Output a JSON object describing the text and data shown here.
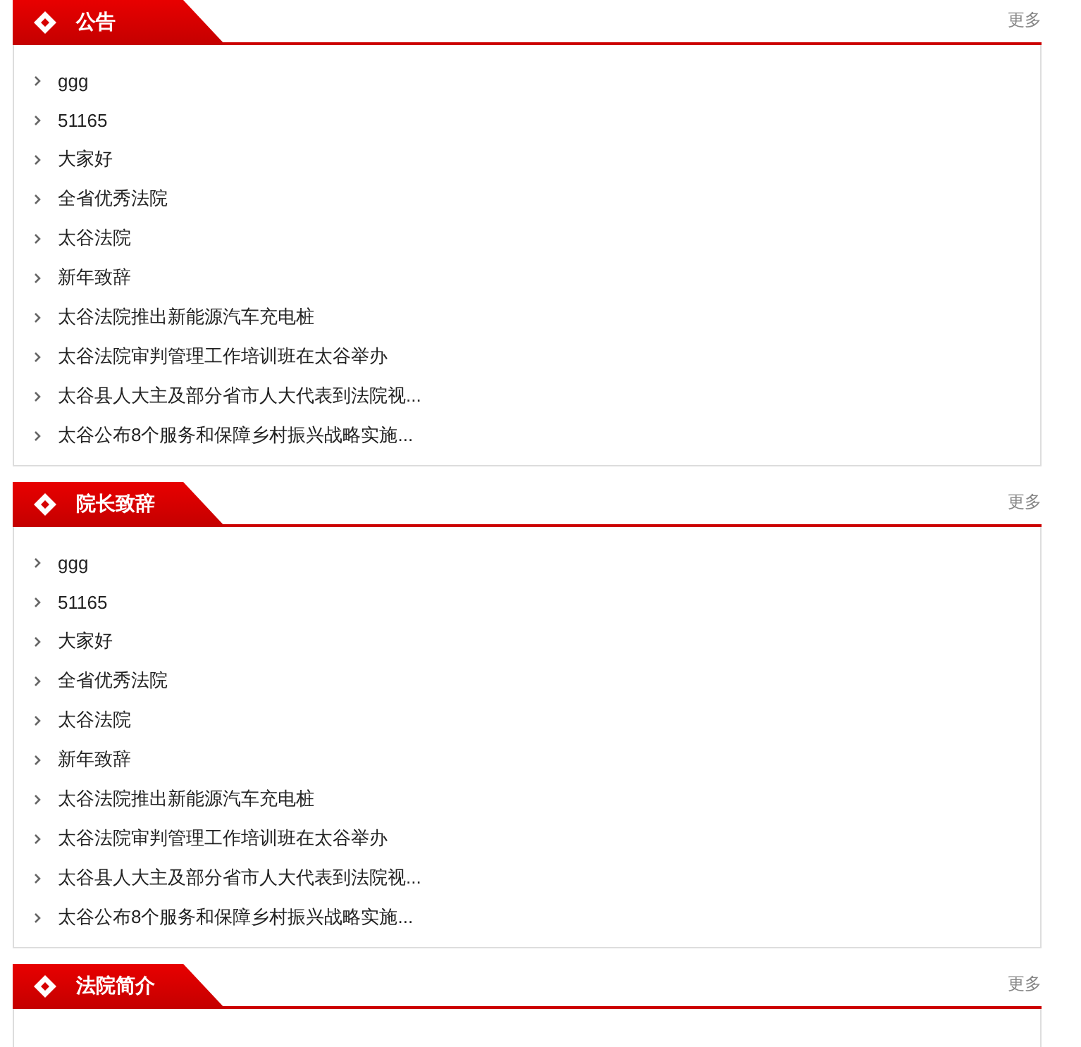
{
  "panels": [
    {
      "title": "公告",
      "more": "更多",
      "items": [
        "ggg",
        "51165",
        "大家好",
        "全省优秀法院",
        "太谷法院",
        "新年致辞",
        "太谷法院推出新能源汽车充电桩",
        "太谷法院审判管理工作培训班在太谷举办",
        "太谷县人大主及部分省市人大代表到法院视...",
        "太谷公布8个服务和保障乡村振兴战略实施..."
      ]
    },
    {
      "title": "院长致辞",
      "more": "更多",
      "items": [
        "ggg",
        "51165",
        "大家好",
        "全省优秀法院",
        "太谷法院",
        "新年致辞",
        "太谷法院推出新能源汽车充电桩",
        "太谷法院审判管理工作培训班在太谷举办",
        "太谷县人大主及部分省市人大代表到法院视...",
        "太谷公布8个服务和保障乡村振兴战略实施..."
      ]
    },
    {
      "title": "法院简介",
      "more": "更多"
    }
  ]
}
